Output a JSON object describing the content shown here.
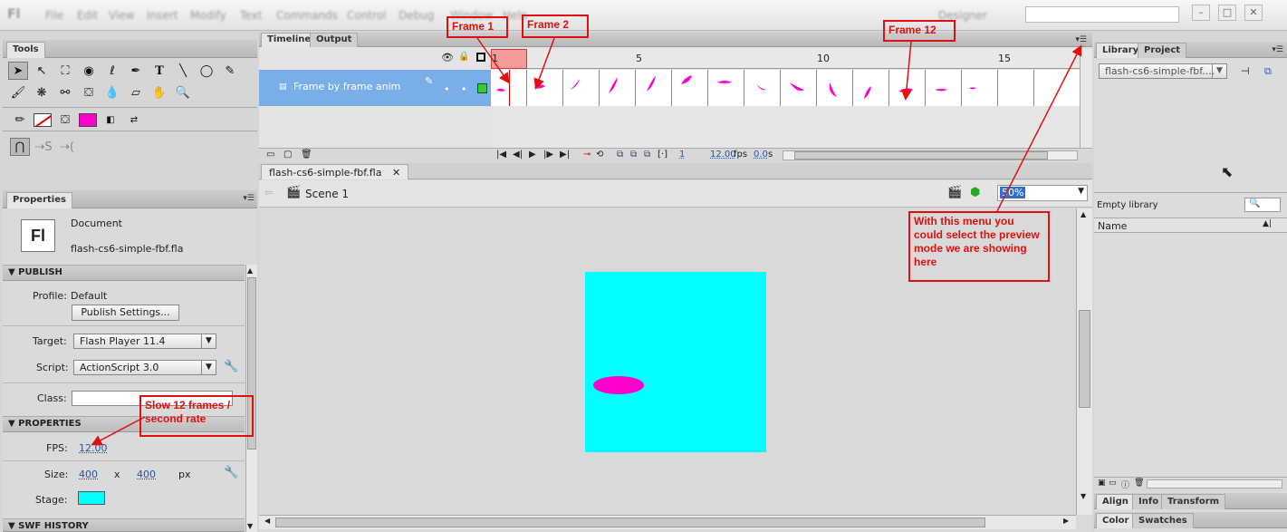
{
  "menubar": {
    "items": [
      "File",
      "Edit",
      "View",
      "Insert",
      "Modify",
      "Text",
      "Commands",
      "Control",
      "Debug",
      "Window",
      "Help"
    ],
    "workspace": "Designer"
  },
  "tools_panel": {
    "tab": "Tools"
  },
  "timeline": {
    "tabs": [
      "Timeline",
      "Output"
    ],
    "layer_name": "Frame by frame anim",
    "frame_numbers": [
      "1",
      "5",
      "10",
      "15"
    ],
    "current_frame": "1",
    "fps": "12.00",
    "fps_unit": "fps",
    "elapsed": "0.0",
    "elapsed_unit": "s"
  },
  "document_tab": "flash-cs6-simple-fbf.fla",
  "stage": {
    "scene": "Scene 1",
    "zoom": "50%",
    "stage_color": "#00ffff",
    "shape_color": "#ff00cc"
  },
  "properties": {
    "tab": "Properties",
    "doc_type": "Document",
    "doc_name": "flash-cs6-simple-fbf.fla",
    "publish_header": "PUBLISH",
    "profile_label": "Profile:",
    "profile_value": "Default",
    "publish_settings": "Publish Settings...",
    "target_label": "Target:",
    "target_value": "Flash Player 11.4",
    "script_label": "Script:",
    "script_value": "ActionScript 3.0",
    "class_label": "Class:",
    "properties_header": "PROPERTIES",
    "fps_label": "FPS:",
    "fps_value": "12.00",
    "size_label": "Size:",
    "width": "400",
    "x": "x",
    "height": "400",
    "px": "px",
    "stage_label": "Stage:",
    "swf_history": "SWF HISTORY"
  },
  "library": {
    "tabs": [
      "Library",
      "Project"
    ],
    "doc_select": "flash-cs6-simple-fbf....",
    "empty": "Empty library",
    "col_name": "Name",
    "bottom_tabs": [
      "Align",
      "Info",
      "Transform"
    ],
    "bottom_tabs2": [
      "Color",
      "Swatches"
    ]
  },
  "callouts": {
    "frame1": "Frame 1",
    "frame2": "Frame 2",
    "frame12": "Frame 12",
    "menu": "With this menu you could select the preview mode we are showing here",
    "fps": "Slow 12 frames / second rate"
  }
}
